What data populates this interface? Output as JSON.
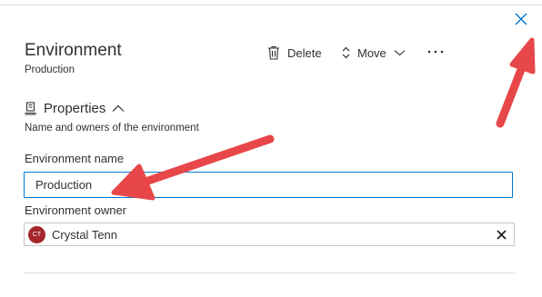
{
  "panel": {
    "title": "Environment",
    "subtitle": "Production"
  },
  "commands": {
    "delete_label": "Delete",
    "move_label": "Move"
  },
  "properties": {
    "heading": "Properties",
    "description": "Name and owners of the environment"
  },
  "fields": {
    "name_label": "Environment name",
    "name_value": "Production",
    "owner_label": "Environment owner",
    "owner_initials": "CT",
    "owner_name": "Crystal Tenn"
  },
  "colors": {
    "accent": "#0078d4",
    "annotation_arrow": "#e8474a",
    "avatar_bg": "#a4262c",
    "text": "#323130"
  },
  "icons": {
    "close": "close-icon",
    "delete": "trash-icon",
    "move": "up-down-icon",
    "move_dropdown": "chevron-down-icon",
    "more": "more-icon",
    "properties": "properties-icon",
    "collapse": "chevron-up-icon",
    "remove_owner": "remove-icon"
  }
}
